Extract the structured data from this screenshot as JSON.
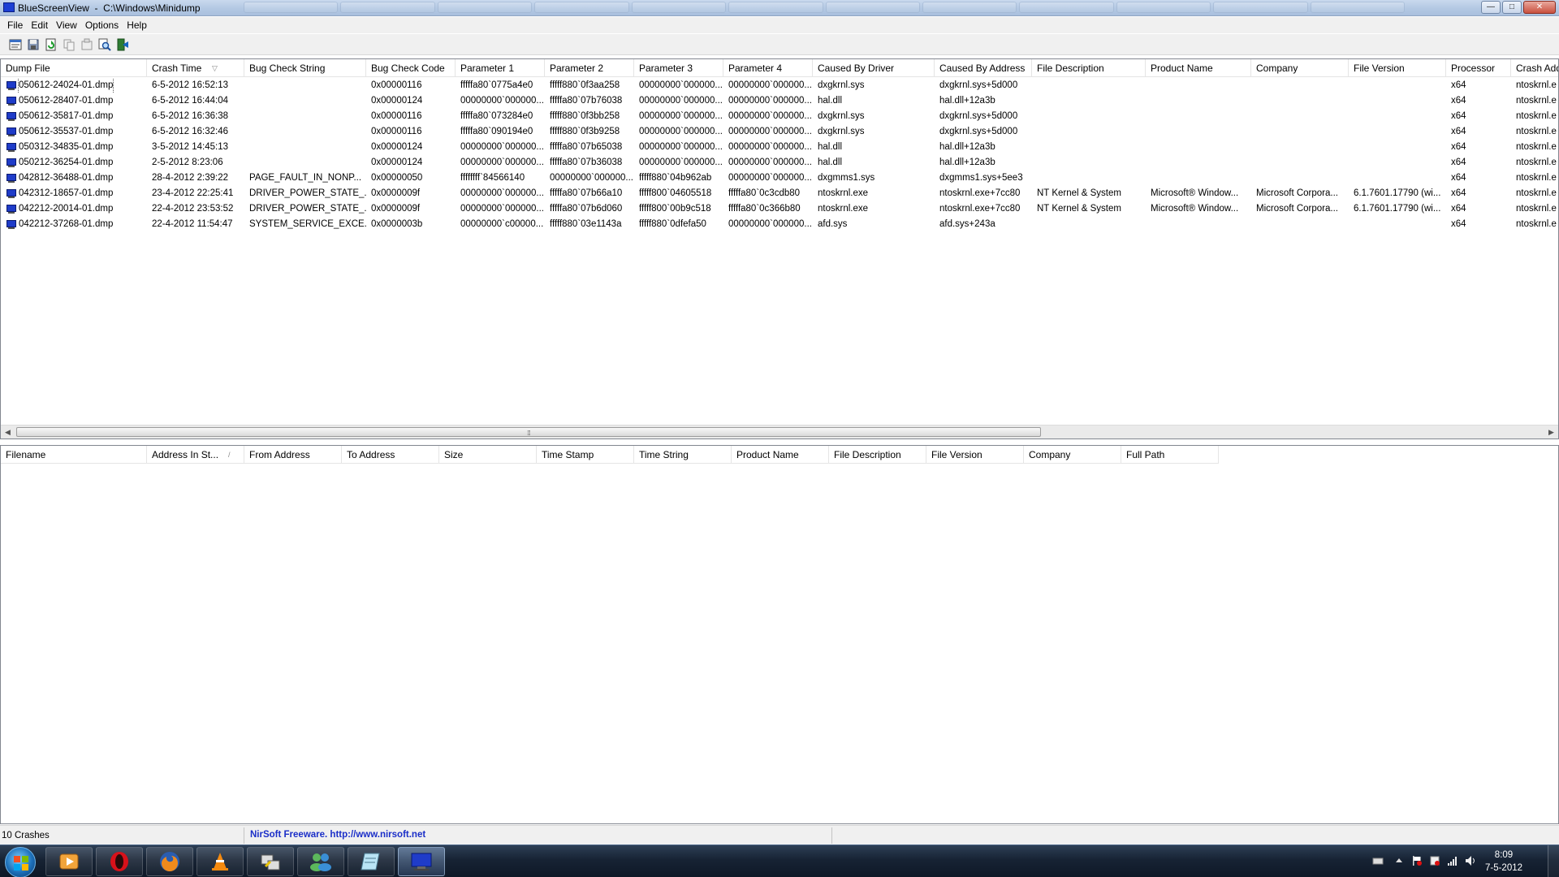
{
  "window": {
    "title": "BlueScreenView  -  C:\\Windows\\Minidump",
    "buttons": {
      "minimize": "—",
      "maximize": "□",
      "close": "✕"
    }
  },
  "menu": [
    "File",
    "Edit",
    "View",
    "Options",
    "Help"
  ],
  "toolbar": [
    "properties-icon",
    "save-icon",
    "refresh-icon",
    "copy-icon",
    "html-report-icon",
    "find-icon",
    "exit-icon"
  ],
  "top_table": {
    "columns": [
      "Dump File",
      "Crash Time",
      "Bug Check String",
      "Bug Check Code",
      "Parameter 1",
      "Parameter 2",
      "Parameter 3",
      "Parameter 4",
      "Caused By Driver",
      "Caused By Address",
      "File Description",
      "Product Name",
      "Company",
      "File Version",
      "Processor",
      "Crash Add"
    ],
    "sort_indicator": "▽",
    "rows": [
      [
        "050612-24024-01.dmp",
        "6-5-2012 16:52:13",
        "",
        "0x00000116",
        "fffffa80`0775a4e0",
        "fffff880`0f3aa258",
        "00000000`000000...",
        "00000000`000000...",
        "dxgkrnl.sys",
        "dxgkrnl.sys+5d000",
        "",
        "",
        "",
        "",
        "x64",
        "ntoskrnl.e"
      ],
      [
        "050612-28407-01.dmp",
        "6-5-2012 16:44:04",
        "",
        "0x00000124",
        "00000000`000000...",
        "fffffa80`07b76038",
        "00000000`000000...",
        "00000000`000000...",
        "hal.dll",
        "hal.dll+12a3b",
        "",
        "",
        "",
        "",
        "x64",
        "ntoskrnl.e"
      ],
      [
        "050612-35817-01.dmp",
        "6-5-2012 16:36:38",
        "",
        "0x00000116",
        "fffffa80`073284e0",
        "fffff880`0f3bb258",
        "00000000`000000...",
        "00000000`000000...",
        "dxgkrnl.sys",
        "dxgkrnl.sys+5d000",
        "",
        "",
        "",
        "",
        "x64",
        "ntoskrnl.e"
      ],
      [
        "050612-35537-01.dmp",
        "6-5-2012 16:32:46",
        "",
        "0x00000116",
        "fffffa80`090194e0",
        "fffff880`0f3b9258",
        "00000000`000000...",
        "00000000`000000...",
        "dxgkrnl.sys",
        "dxgkrnl.sys+5d000",
        "",
        "",
        "",
        "",
        "x64",
        "ntoskrnl.e"
      ],
      [
        "050312-34835-01.dmp",
        "3-5-2012 14:45:13",
        "",
        "0x00000124",
        "00000000`000000...",
        "fffffa80`07b65038",
        "00000000`000000...",
        "00000000`000000...",
        "hal.dll",
        "hal.dll+12a3b",
        "",
        "",
        "",
        "",
        "x64",
        "ntoskrnl.e"
      ],
      [
        "050212-36254-01.dmp",
        "2-5-2012 8:23:06",
        "",
        "0x00000124",
        "00000000`000000...",
        "fffffa80`07b36038",
        "00000000`000000...",
        "00000000`000000...",
        "hal.dll",
        "hal.dll+12a3b",
        "",
        "",
        "",
        "",
        "x64",
        "ntoskrnl.e"
      ],
      [
        "042812-36488-01.dmp",
        "28-4-2012 2:39:22",
        "PAGE_FAULT_IN_NONP...",
        "0x00000050",
        "ffffffff`84566140",
        "00000000`000000...",
        "fffff880`04b962ab",
        "00000000`000000...",
        "dxgmms1.sys",
        "dxgmms1.sys+5ee3",
        "",
        "",
        "",
        "",
        "x64",
        "ntoskrnl.e"
      ],
      [
        "042312-18657-01.dmp",
        "23-4-2012 22:25:41",
        "DRIVER_POWER_STATE_...",
        "0x0000009f",
        "00000000`000000...",
        "fffffa80`07b66a10",
        "fffff800`04605518",
        "fffffa80`0c3cdb80",
        "ntoskrnl.exe",
        "ntoskrnl.exe+7cc80",
        "NT Kernel & System",
        "Microsoft® Window...",
        "Microsoft Corpora...",
        "6.1.7601.17790 (wi...",
        "x64",
        "ntoskrnl.e"
      ],
      [
        "042212-20014-01.dmp",
        "22-4-2012 23:53:52",
        "DRIVER_POWER_STATE_...",
        "0x0000009f",
        "00000000`000000...",
        "fffffa80`07b6d060",
        "fffff800`00b9c518",
        "fffffa80`0c366b80",
        "ntoskrnl.exe",
        "ntoskrnl.exe+7cc80",
        "NT Kernel & System",
        "Microsoft® Window...",
        "Microsoft Corpora...",
        "6.1.7601.17790 (wi...",
        "x64",
        "ntoskrnl.e"
      ],
      [
        "042212-37268-01.dmp",
        "22-4-2012 11:54:47",
        "SYSTEM_SERVICE_EXCE...",
        "0x0000003b",
        "00000000`c00000...",
        "fffff880`03e1143a",
        "fffff880`0dfefa50",
        "00000000`000000...",
        "afd.sys",
        "afd.sys+243a",
        "",
        "",
        "",
        "",
        "x64",
        "ntoskrnl.e"
      ]
    ]
  },
  "bottom_table": {
    "columns": [
      "Filename",
      "Address In St...",
      "From Address",
      "To Address",
      "Size",
      "Time Stamp",
      "Time String",
      "Product Name",
      "File Description",
      "File Version",
      "Company",
      "Full Path"
    ],
    "sort_indicator": "/"
  },
  "scrollbar": {
    "left_arrow": "◀",
    "right_arrow": "▶",
    "grip": "⁞⁞⁞"
  },
  "status": {
    "count": "10 Crashes",
    "link": "NirSoft Freeware.  http://www.nirsoft.net"
  },
  "taskbar": {
    "apps": [
      "media-player-icon",
      "opera-icon",
      "firefox-icon",
      "vlc-icon",
      "network-tool-icon",
      "messenger-icon",
      "notepad-icon",
      "bluescreenview-icon"
    ],
    "clock_time": "8:09",
    "clock_date": "7-5-2012",
    "colors": {
      "accent": "#1f3cc9",
      "link": "#1a2ec8"
    }
  }
}
